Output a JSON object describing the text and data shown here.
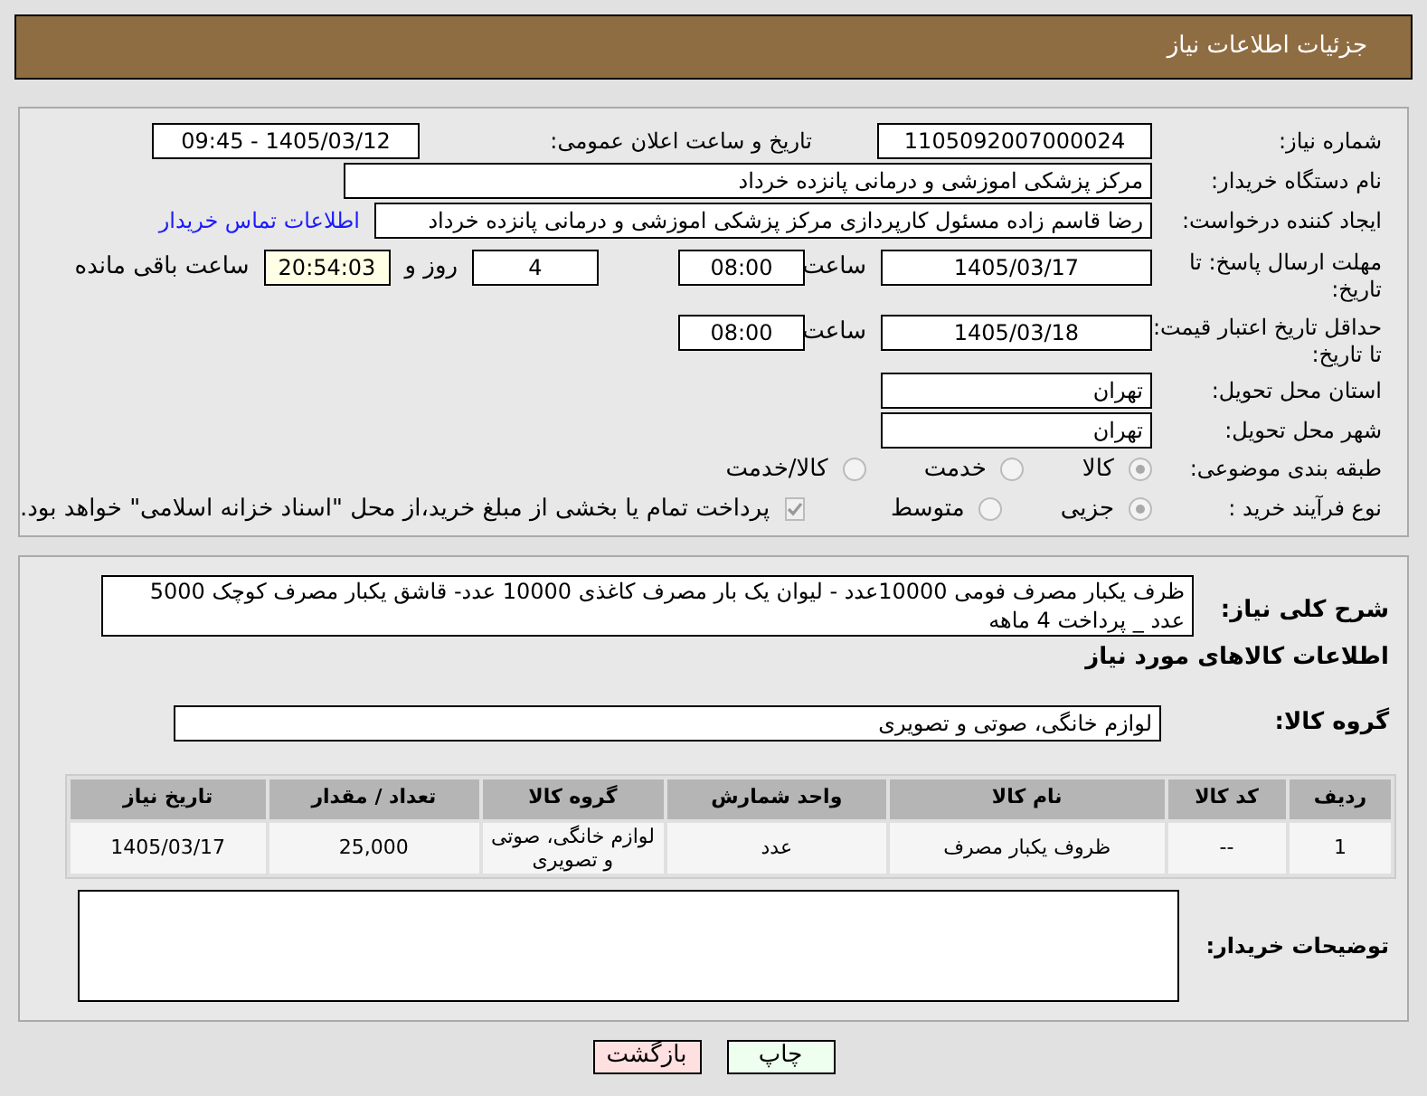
{
  "header": {
    "title": "جزئیات اطلاعات نیاز"
  },
  "need_number": {
    "label": "شماره نیاز:",
    "value": "1105092007000024"
  },
  "announce": {
    "label": "تاریخ و ساعت اعلان عمومی:",
    "value": "1405/03/12 - 09:45"
  },
  "buyer_org": {
    "label": "نام دستگاه خریدار:",
    "value": "مرکز پزشکی  اموزشی و درمانی پانزده خرداد"
  },
  "requester": {
    "label": "ایجاد کننده درخواست:",
    "value": "رضا قاسم زاده مسئول کارپردازی مرکز پزشکی  اموزشی و درمانی پانزده خرداد",
    "link": "اطلاعات تماس خریدار"
  },
  "response_deadline": {
    "label": "مهلت ارسال پاسخ: تا تاریخ:",
    "date": "1405/03/17",
    "time_label": "ساعت",
    "time": "08:00",
    "days": "4",
    "days_label": "روز و",
    "remaining": "20:54:03",
    "remaining_label": "ساعت باقی مانده"
  },
  "price_validity": {
    "label": "حداقل تاریخ اعتبار قیمت: تا تاریخ:",
    "date": "1405/03/18",
    "time_label": "ساعت",
    "time": "08:00"
  },
  "province": {
    "label": "استان محل تحویل:",
    "value": "تهران"
  },
  "city": {
    "label": "شهر محل تحویل:",
    "value": "تهران"
  },
  "category": {
    "label": "طبقه بندی موضوعی:",
    "options": [
      {
        "label": "کالا",
        "selected": true
      },
      {
        "label": "خدمت",
        "selected": false
      },
      {
        "label": "کالا/خدمت",
        "selected": false
      }
    ]
  },
  "process": {
    "label": "نوع فرآیند خرید :",
    "options": [
      {
        "label": "جزیی",
        "selected": true
      },
      {
        "label": "متوسط",
        "selected": false
      }
    ],
    "payment_note": {
      "text": "پرداخت تمام یا بخشی از مبلغ خرید،از محل \"اسناد خزانه اسلامی\" خواهد بود.",
      "checked": true
    }
  },
  "description": {
    "label": "شرح کلی نیاز:",
    "value": "ظرف یکبار مصرف فومی 10000عدد - لیوان یک بار مصرف کاغذی 10000 عدد- قاشق یکبار مصرف کوچک 5000 عدد _ پرداخت 4 ماهه"
  },
  "goods_title": "اطلاعات کالاهای مورد نیاز",
  "goods_group": {
    "label": "گروه کالا:",
    "value": "لوازم خانگی، صوتی و تصویری"
  },
  "table": {
    "columns": [
      "ردیف",
      "کد کالا",
      "نام کالا",
      "واحد شمارش",
      "گروه کالا",
      "تعداد / مقدار",
      "تاریخ نیاز"
    ],
    "rows": [
      [
        "1",
        "--",
        "ظروف یکبار مصرف",
        "عدد",
        "لوازم خانگی، صوتی و تصویری",
        "25,000",
        "1405/03/17"
      ]
    ]
  },
  "buyer_notes": {
    "label": "توضیحات خریدار:"
  },
  "buttons": [
    {
      "label": "چاپ",
      "kind": "print"
    },
    {
      "label": "بازگشت",
      "kind": "back"
    }
  ]
}
